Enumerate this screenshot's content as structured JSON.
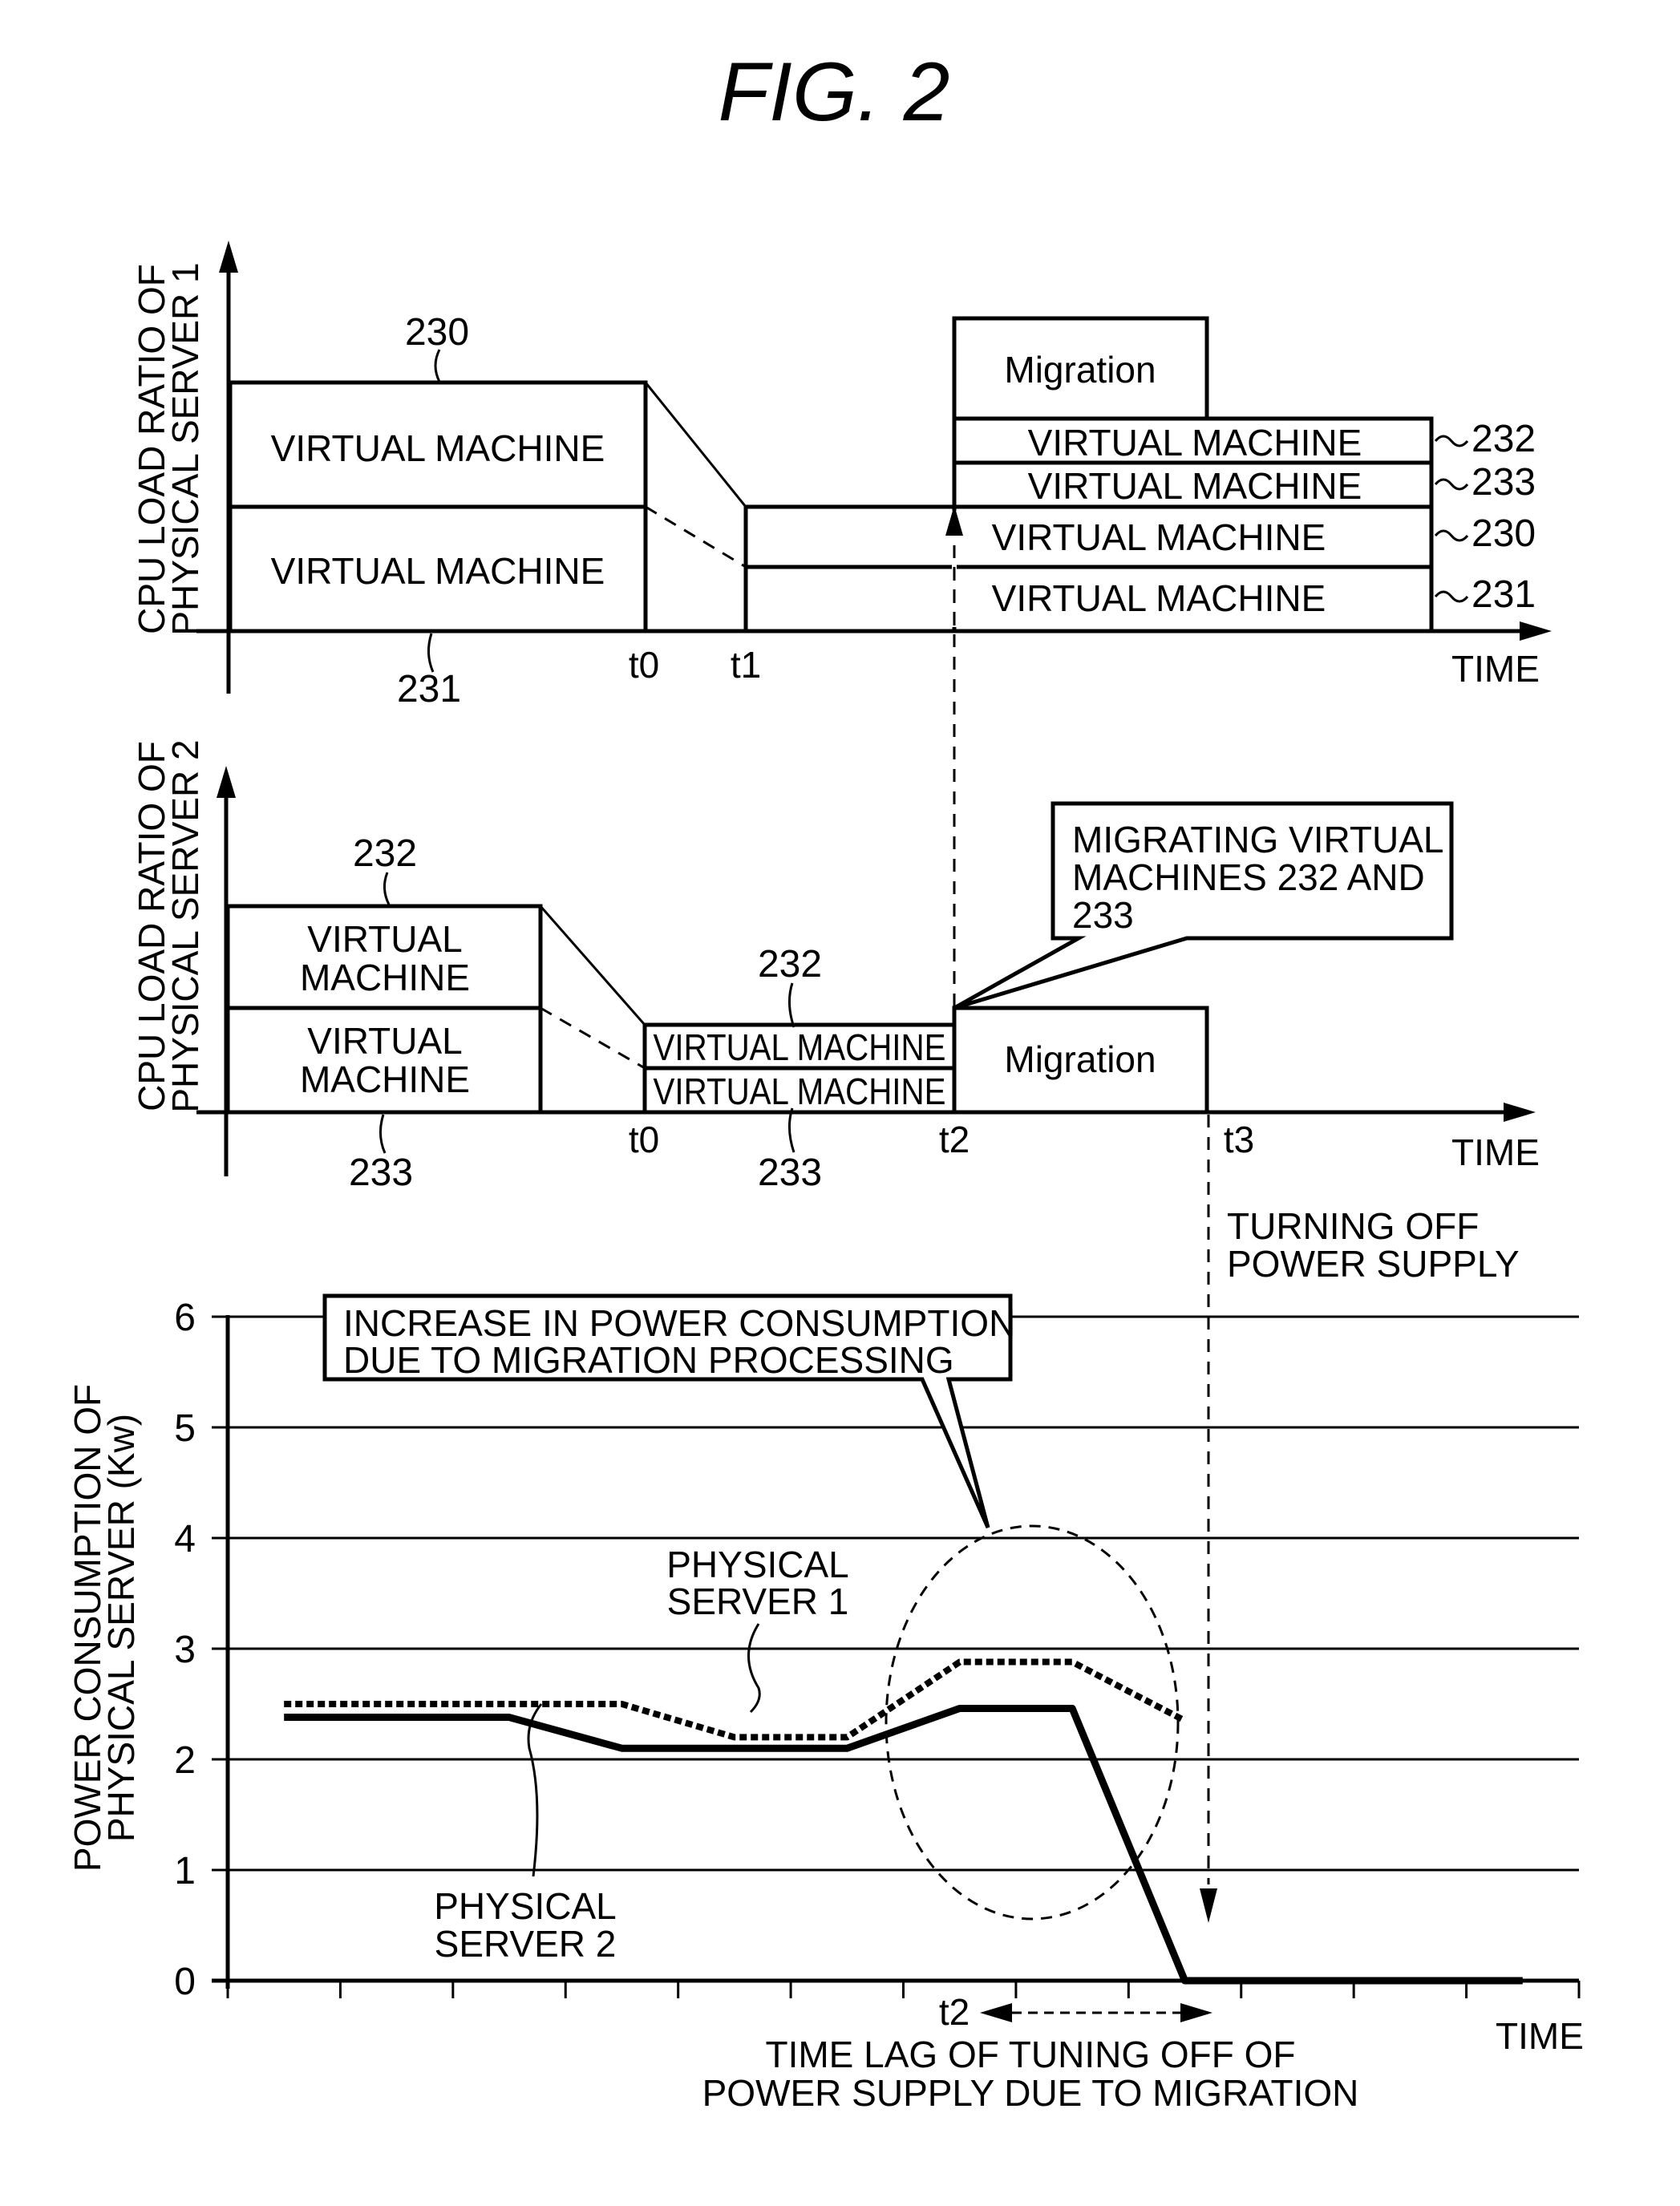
{
  "figure": {
    "title": "FIG.  2"
  },
  "panel1": {
    "ylabel_line1": "CPU LOAD RATIO OF",
    "ylabel_line2": "PHYSICAL SERVER 1",
    "xlabel": "TIME",
    "ticks": [
      "t0",
      "t1"
    ],
    "vm_label": "VIRTUAL MACHINE",
    "migration_label": "Migration",
    "refs": {
      "left_top": "230",
      "left_bottom": "231",
      "right_232": "232",
      "right_233": "233",
      "right_230": "230",
      "right_231": "231"
    }
  },
  "panel2": {
    "ylabel_line1": "CPU LOAD RATIO OF",
    "ylabel_line2": "PHYSICAL SERVER 2",
    "xlabel": "TIME",
    "ticks": [
      "t0",
      "t2",
      "t3"
    ],
    "vm_label_line1": "VIRTUAL",
    "vm_label_line2": "MACHINE",
    "vm_label": "VIRTUAL MACHINE",
    "migration_label": "Migration",
    "callout_lines": [
      "MIGRATING VIRTUAL",
      "MACHINES 232 AND",
      "233"
    ],
    "refs": {
      "left_top": "232",
      "left_bottom": "233",
      "mid_top": "232",
      "mid_bottom": "233"
    },
    "power_off_lines": [
      "TURNING OFF",
      "POWER SUPPLY"
    ]
  },
  "chart_data": {
    "type": "line",
    "title": "",
    "xlabel": "TIME",
    "ylabel": "POWER CONSUMPTION OF PHYSICAL SERVER (Kw)",
    "ylabel_lines": [
      "POWER CONSUMPTION OF",
      "PHYSICAL SERVER (Kw)"
    ],
    "ylim": [
      0,
      6
    ],
    "yticks": [
      "0",
      "1",
      "2",
      "3",
      "4",
      "5",
      "6"
    ],
    "xlim": [
      0,
      12
    ],
    "x_tick_count": 12,
    "grid": true,
    "x_marker": {
      "label": "t2",
      "x": 6.4
    },
    "series": [
      {
        "name": "PHYSICAL SERVER 1",
        "label_lines": [
          "PHYSICAL",
          "SERVER 1"
        ],
        "style": "dotted",
        "x": [
          0.5,
          3.5,
          4.5,
          5.5,
          6.5,
          7.5,
          8.5
        ],
        "values": [
          2.5,
          2.5,
          2.2,
          2.2,
          2.88,
          2.88,
          2.35
        ]
      },
      {
        "name": "PHYSICAL SERVER 2",
        "label_lines": [
          "PHYSICAL",
          "SERVER 2"
        ],
        "style": "solid",
        "x": [
          0.5,
          2.5,
          3.5,
          5.5,
          6.5,
          7.5,
          8.5,
          11.5
        ],
        "values": [
          2.38,
          2.38,
          2.1,
          2.1,
          2.46,
          2.46,
          0,
          0
        ]
      }
    ],
    "annotations": {
      "callout_lines": [
        "INCREASE IN POWER CONSUMPTION",
        "DUE TO MIGRATION PROCESSING"
      ],
      "time_lag_lines": [
        "TIME LAG OF TUNING OFF OF",
        "POWER SUPPLY DUE TO MIGRATION"
      ]
    }
  }
}
